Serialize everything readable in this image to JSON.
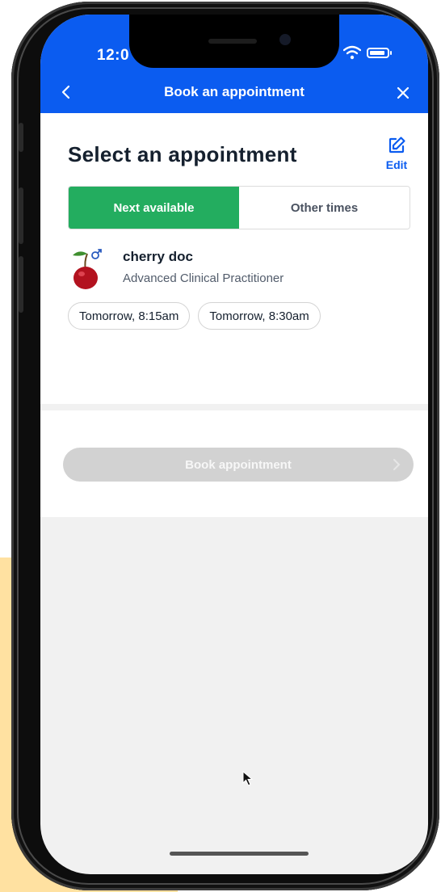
{
  "status_bar": {
    "time": "12:0",
    "wifi_icon": "wifi-icon",
    "battery_icon": "battery-icon"
  },
  "nav": {
    "back_icon": "chevron-left-icon",
    "title": "Book an appointment",
    "close_icon": "close-icon"
  },
  "page": {
    "heading": "Select an appointment",
    "edit_label": "Edit",
    "edit_icon": "edit-icon"
  },
  "tabs": [
    {
      "label": "Next available",
      "active": true
    },
    {
      "label": "Other times",
      "active": false
    }
  ],
  "practitioner": {
    "name": "cherry doc",
    "role": "Advanced Clinical Practitioner",
    "avatar_icon": "cherry-icon"
  },
  "slots": [
    {
      "label": "Tomorrow, 8:15am"
    },
    {
      "label": "Tomorrow, 8:30am"
    }
  ],
  "footer": {
    "book_label": "Book appointment",
    "chevron_icon": "chevron-right-icon"
  },
  "colors": {
    "header_blue": "#0b5cf0",
    "active_tab_green": "#23ad5f",
    "disabled_button": "#d2d2d2",
    "background_accent": "#ffe1a1"
  }
}
